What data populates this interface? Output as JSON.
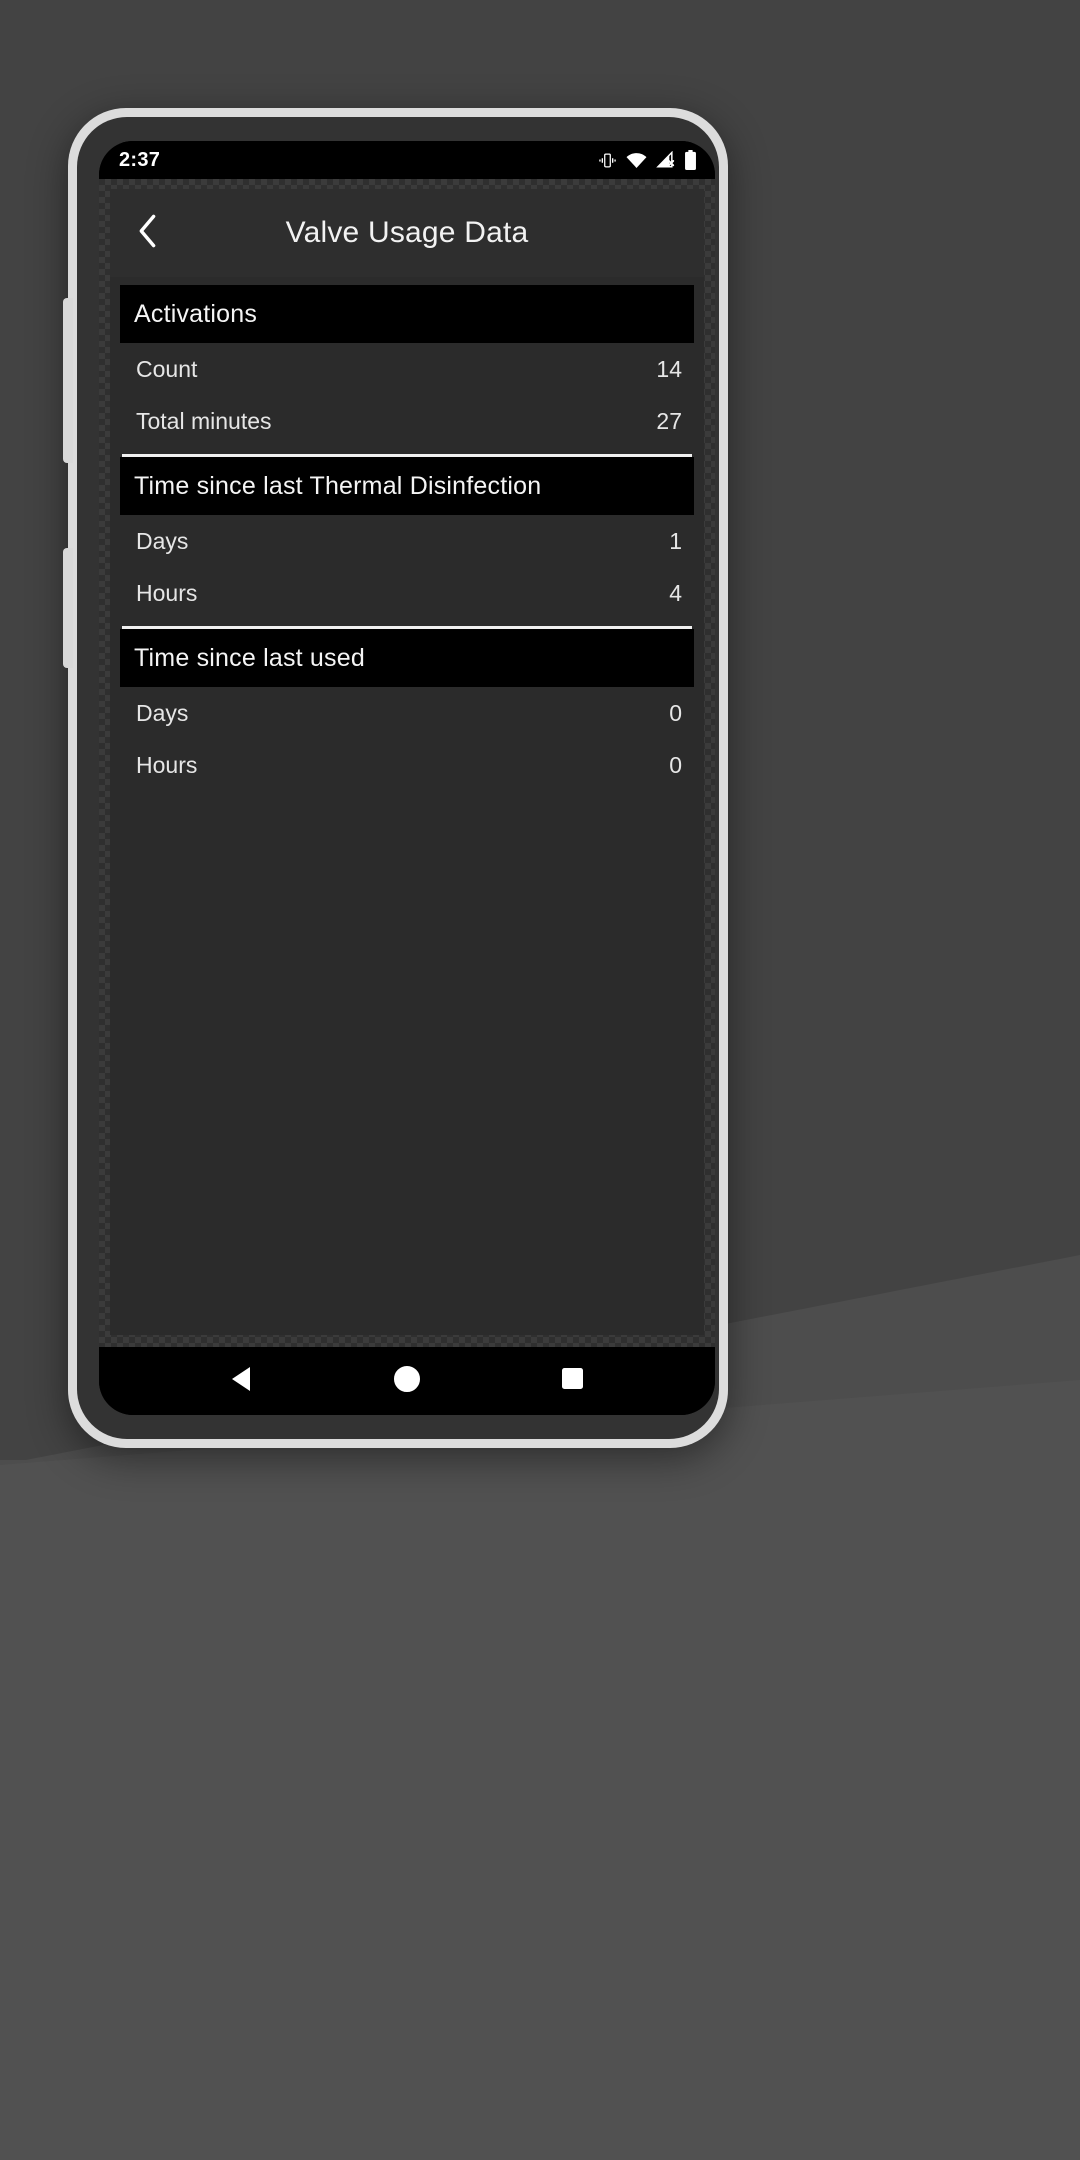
{
  "status_bar": {
    "clock": "2:37",
    "icons": [
      "vibrate-icon",
      "wifi-icon",
      "cellular-no-signal-icon",
      "battery-icon"
    ]
  },
  "app_bar": {
    "back_icon": "chevron-left-icon",
    "title": "Valve Usage Data"
  },
  "sections": [
    {
      "title": "Activations",
      "rows": [
        {
          "label": "Count",
          "value": "14"
        },
        {
          "label": "Total minutes",
          "value": "27"
        }
      ]
    },
    {
      "title": "Time since last Thermal Disinfection",
      "rows": [
        {
          "label": "Days",
          "value": "1"
        },
        {
          "label": "Hours",
          "value": "4"
        }
      ]
    },
    {
      "title": "Time since last used",
      "rows": [
        {
          "label": "Days",
          "value": "0"
        },
        {
          "label": "Hours",
          "value": "0"
        }
      ]
    }
  ],
  "nav_bar": {
    "back": "back-triangle-icon",
    "home": "home-circle-icon",
    "recents": "recents-square-icon"
  },
  "colors": {
    "screen_background": "#2b2b2b",
    "section_header_background": "#000000",
    "app_bar_background": "#2e2e2e",
    "text_primary": "#e6e6e6",
    "divider": "#f0f0f0"
  }
}
